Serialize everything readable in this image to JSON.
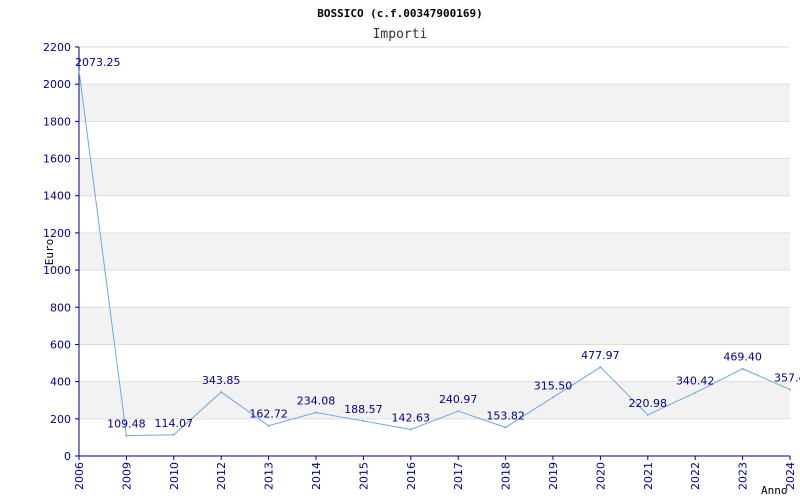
{
  "chart_data": {
    "type": "line",
    "title": "BOSSICO (c.f.00347900169)",
    "subtitle": "Importi",
    "xlabel": "Anno",
    "ylabel": "Euro",
    "ylim": [
      0,
      2200
    ],
    "y_ticks": [
      "0",
      "200",
      "400",
      "600",
      "800",
      "1000",
      "1200",
      "1400",
      "1600",
      "1800",
      "2000",
      "2200"
    ],
    "categories": [
      "2006",
      "2009",
      "2010",
      "2012",
      "2013",
      "2014",
      "2015",
      "2016",
      "2017",
      "2018",
      "2019",
      "2020",
      "2021",
      "2022",
      "2023",
      "2024"
    ],
    "values": [
      2073.25,
      109.48,
      114.07,
      343.85,
      162.72,
      234.08,
      188.57,
      142.63,
      240.97,
      153.82,
      315.5,
      477.97,
      220.98,
      340.42,
      469.4,
      357.4
    ],
    "data_labels": [
      "2073.25",
      "109.48",
      "114.07",
      "343.85",
      "162.72",
      "234.08",
      "188.57",
      "142.63",
      "240.97",
      "153.82",
      "315.50",
      "477.97",
      "220.98",
      "340.42",
      "469.40",
      "357.4"
    ],
    "grid": true,
    "line_color": "#6fa8dc",
    "band_color": "#f2f2f2",
    "axis_color": "#00008b"
  }
}
